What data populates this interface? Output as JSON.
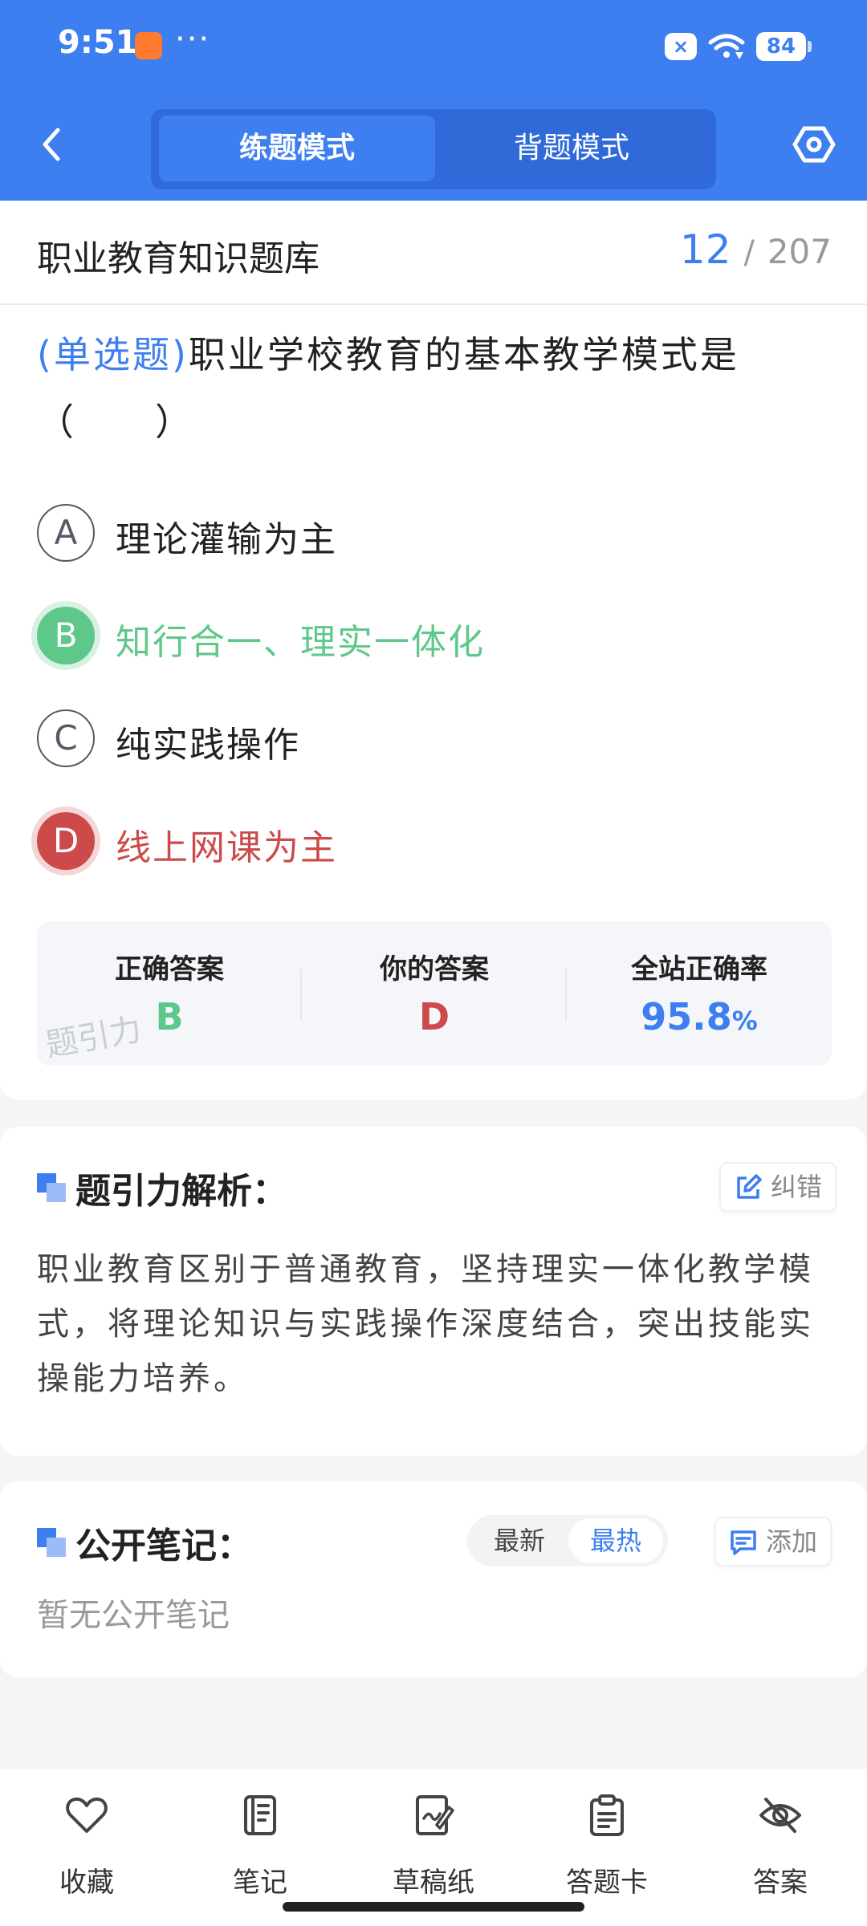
{
  "status_bar": {
    "time": "9:51",
    "dots": "···",
    "battery": "84"
  },
  "header": {
    "tabs": [
      {
        "label": "练题模式"
      },
      {
        "label": "背题模式"
      }
    ]
  },
  "question": {
    "bank_name": "职业教育知识题库",
    "current": "12",
    "separator": "/",
    "total": "207",
    "type_label": "(单选题)",
    "text": "职业学校教育的基本教学模式是（　　）",
    "options": [
      {
        "letter": "A",
        "text": "理论灌输为主",
        "state": "normal"
      },
      {
        "letter": "B",
        "text": "知行合一、理实一体化",
        "state": "correct"
      },
      {
        "letter": "C",
        "text": "纯实践操作",
        "state": "normal"
      },
      {
        "letter": "D",
        "text": "线上网课为主",
        "state": "wrong"
      }
    ]
  },
  "stats": {
    "correct_label": "正确答案",
    "correct_value": "B",
    "yours_label": "你的答案",
    "yours_value": "D",
    "rate_label": "全站正确率",
    "rate_value": "95.8",
    "rate_unit": "%",
    "watermark": "题引力"
  },
  "analysis": {
    "title": "题引力解析：",
    "report_label": "纠错",
    "text": "职业教育区别于普通教育，坚持理实一体化教学模式，将理论知识与实践操作深度结合，突出技能实操能力培养。"
  },
  "notes": {
    "title": "公开笔记：",
    "sort_new": "最新",
    "sort_hot": "最热",
    "add_label": "添加",
    "empty_text": "暂无公开笔记"
  },
  "bottom_nav": [
    {
      "label": "收藏"
    },
    {
      "label": "笔记"
    },
    {
      "label": "草稿纸"
    },
    {
      "label": "答题卡"
    },
    {
      "label": "答案"
    }
  ],
  "colors": {
    "brand": "#3d7ef0",
    "correct": "#5ec78a",
    "wrong": "#cd4a4a"
  }
}
